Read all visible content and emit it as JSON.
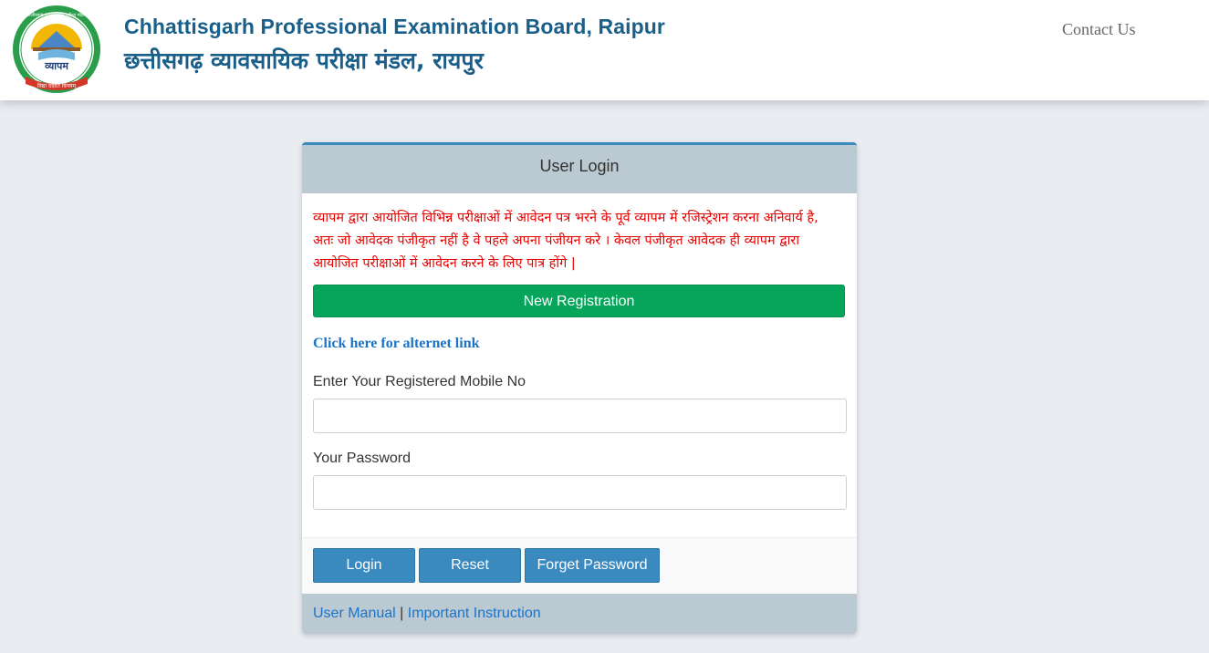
{
  "header": {
    "title_en": "Chhattisgarh Professional Examination Board, Raipur",
    "title_hi": "छत्तीसगढ़ व्यावसायिक परीक्षा मंडल, रायपुर",
    "contact_label": "Contact Us",
    "logo": {
      "icon": "cg-vyapam-emblem",
      "ring_text": "छत्तीसगढ़ व्यावसायिक परीक्षा मंडल",
      "center_text": "व्यापम",
      "ribbon_text": "विद्या ददाति विनयम्",
      "colors": {
        "ring": "#2a9d4a",
        "ribbon": "#d4362a",
        "sun": "#f2b705"
      }
    }
  },
  "login": {
    "title": "User Login",
    "notice": "व्यापम द्वारा आयोजित विभिन्न  परीक्षाओं में आवेदन पत्र भरने के पूर्व व्यापम में रजिस्ट्रेशन करना अनिवार्य है, अतः जो आवेदक पंजीकृत नहीं है वे पहले अपना  पंजीयन करे ।  केवल पंजीकृत आवेदक ही व्यापम द्वारा आयोजित परीक्षाओं में आवेदन करने के लिए पात्र होंगे |",
    "new_registration_label": "New Registration",
    "alt_link_label": "Click here for alternet link",
    "mobile_label": "Enter Your Registered Mobile No",
    "mobile_value": "",
    "password_label": "Your Password",
    "password_value": "",
    "login_label": "Login",
    "reset_label": "Reset",
    "forget_label": "Forget Password",
    "user_manual_label": "User Manual",
    "separator": "|",
    "important_label": "Important Instruction"
  },
  "colors": {
    "brand_blue": "#1a5f8a",
    "button_blue": "#3a8ac0",
    "register_green": "#06a55a",
    "notice_red": "#e60000",
    "link_blue": "#1b74c7"
  }
}
